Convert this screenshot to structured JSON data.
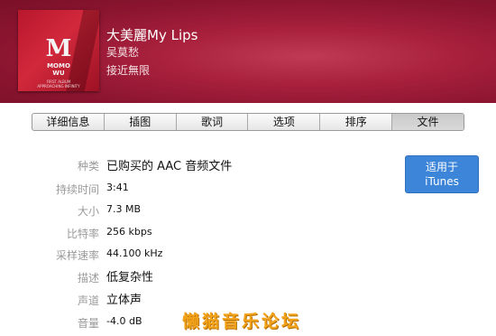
{
  "header": {
    "cover_art": {
      "logo_letter": "M",
      "logo_text_1": "MOMO",
      "logo_text_2": "WU",
      "fine_print_1": "FIRST ALBUM",
      "fine_print_2": "APPROACHING INFINITY"
    },
    "song_title": "大美麗My Lips",
    "artist": "吴莫愁",
    "album": "接近無限"
  },
  "tabs": [
    {
      "label": "详细信息",
      "active": false
    },
    {
      "label": "插图",
      "active": false
    },
    {
      "label": "歌词",
      "active": false
    },
    {
      "label": "选项",
      "active": false
    },
    {
      "label": "排序",
      "active": false
    },
    {
      "label": "文件",
      "active": true
    }
  ],
  "file_info": {
    "kind": {
      "label": "种类",
      "value": "已购买的 AAC 音频文件"
    },
    "duration": {
      "label": "持续时间",
      "value": "3:41"
    },
    "size": {
      "label": "大小",
      "value": "7.3 MB"
    },
    "bit_rate": {
      "label": "比特率",
      "value": "256 kbps"
    },
    "sample_rate": {
      "label": "采样速率",
      "value": "44.100 kHz"
    },
    "profile": {
      "label": "描述",
      "value": "低复杂性"
    },
    "channels": {
      "label": "声道",
      "value": "立体声"
    },
    "volume": {
      "label": "音量",
      "value": "-4.0 dB"
    }
  },
  "itunes_button": {
    "line1": "适用于",
    "line2": "iTunes"
  },
  "watermark": "懒猫音乐论坛",
  "colors": {
    "header_bg": "#a8203c",
    "button_bg": "#3c85d9",
    "watermark": "#f3a31a"
  }
}
